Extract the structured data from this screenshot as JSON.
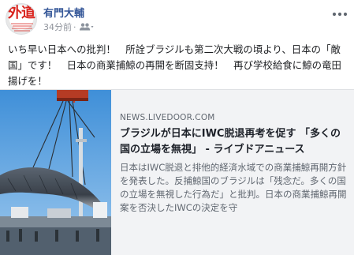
{
  "post": {
    "author": "有門大輔",
    "time": "34分前",
    "separator": "·",
    "avatar_text": "外道",
    "text": "いち早い日本への批判！　所詮ブラジルも第二次大戦の頃より、日本の「敵国」です！　日本の商業捕鯨の再開を断固支持！　再び学校給食に鯨の竜田揚げを！"
  },
  "icons": {
    "privacy": "people-icon",
    "more": "more-options-icon"
  },
  "link_card": {
    "domain": "NEWS.LIVEDOOR.COM",
    "title": "ブラジルが日本にIWC脱退再考を促す 「多くの国の立場を無視」 - ライブドアニュース",
    "description": "日本はIWC脱退と排他的経済水域での商業捕鯨再開方針を発表した。反捕鯨国のブラジルは「残念だ。多くの国の立場を無視した行為だ」と批判。日本の商業捕鯨再開案を否決したIWCの決定を守"
  },
  "colors": {
    "author": "#365899",
    "meta": "#90949c",
    "card_bg": "#f2f3f5"
  }
}
